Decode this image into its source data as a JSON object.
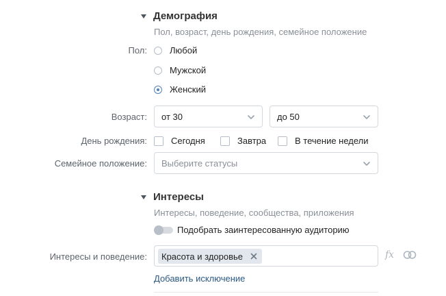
{
  "demography": {
    "title": "Демография",
    "subtitle": "Пол, возраст, день рождения, семейное положение",
    "gender_label": "Пол:",
    "gender_options": [
      "Любой",
      "Мужской",
      "Женский"
    ],
    "gender_selected": "Женский",
    "age_label": "Возраст:",
    "age_from": "от 30",
    "age_to": "до 50",
    "birthday_label": "День рождения:",
    "birthday_options": [
      "Сегодня",
      "Завтра",
      "В течение недели"
    ],
    "marital_label": "Семейное положение:",
    "marital_placeholder": "Выберите статусы"
  },
  "interests": {
    "title": "Интересы",
    "subtitle": "Интересы, поведение, сообщества, приложения",
    "toggle_label": "Подобрать заинтересованную аудиторию",
    "toggle_on": false,
    "field_label": "Интересы и поведение:",
    "tags": [
      "Красота и здоровье"
    ],
    "add_exclusion": "Добавить исключение",
    "fx_label": "fx"
  },
  "colors": {
    "accent": "#5181b8",
    "link": "#2a5885",
    "muted_text": "#8a8f96",
    "border": "#d3d9de",
    "tag_bg": "#e1e7ed"
  },
  "icons": [
    "collapse-arrow-icon",
    "chevron-down-icon",
    "remove-tag-icon",
    "fx-icon",
    "intersection-circles-icon"
  ]
}
